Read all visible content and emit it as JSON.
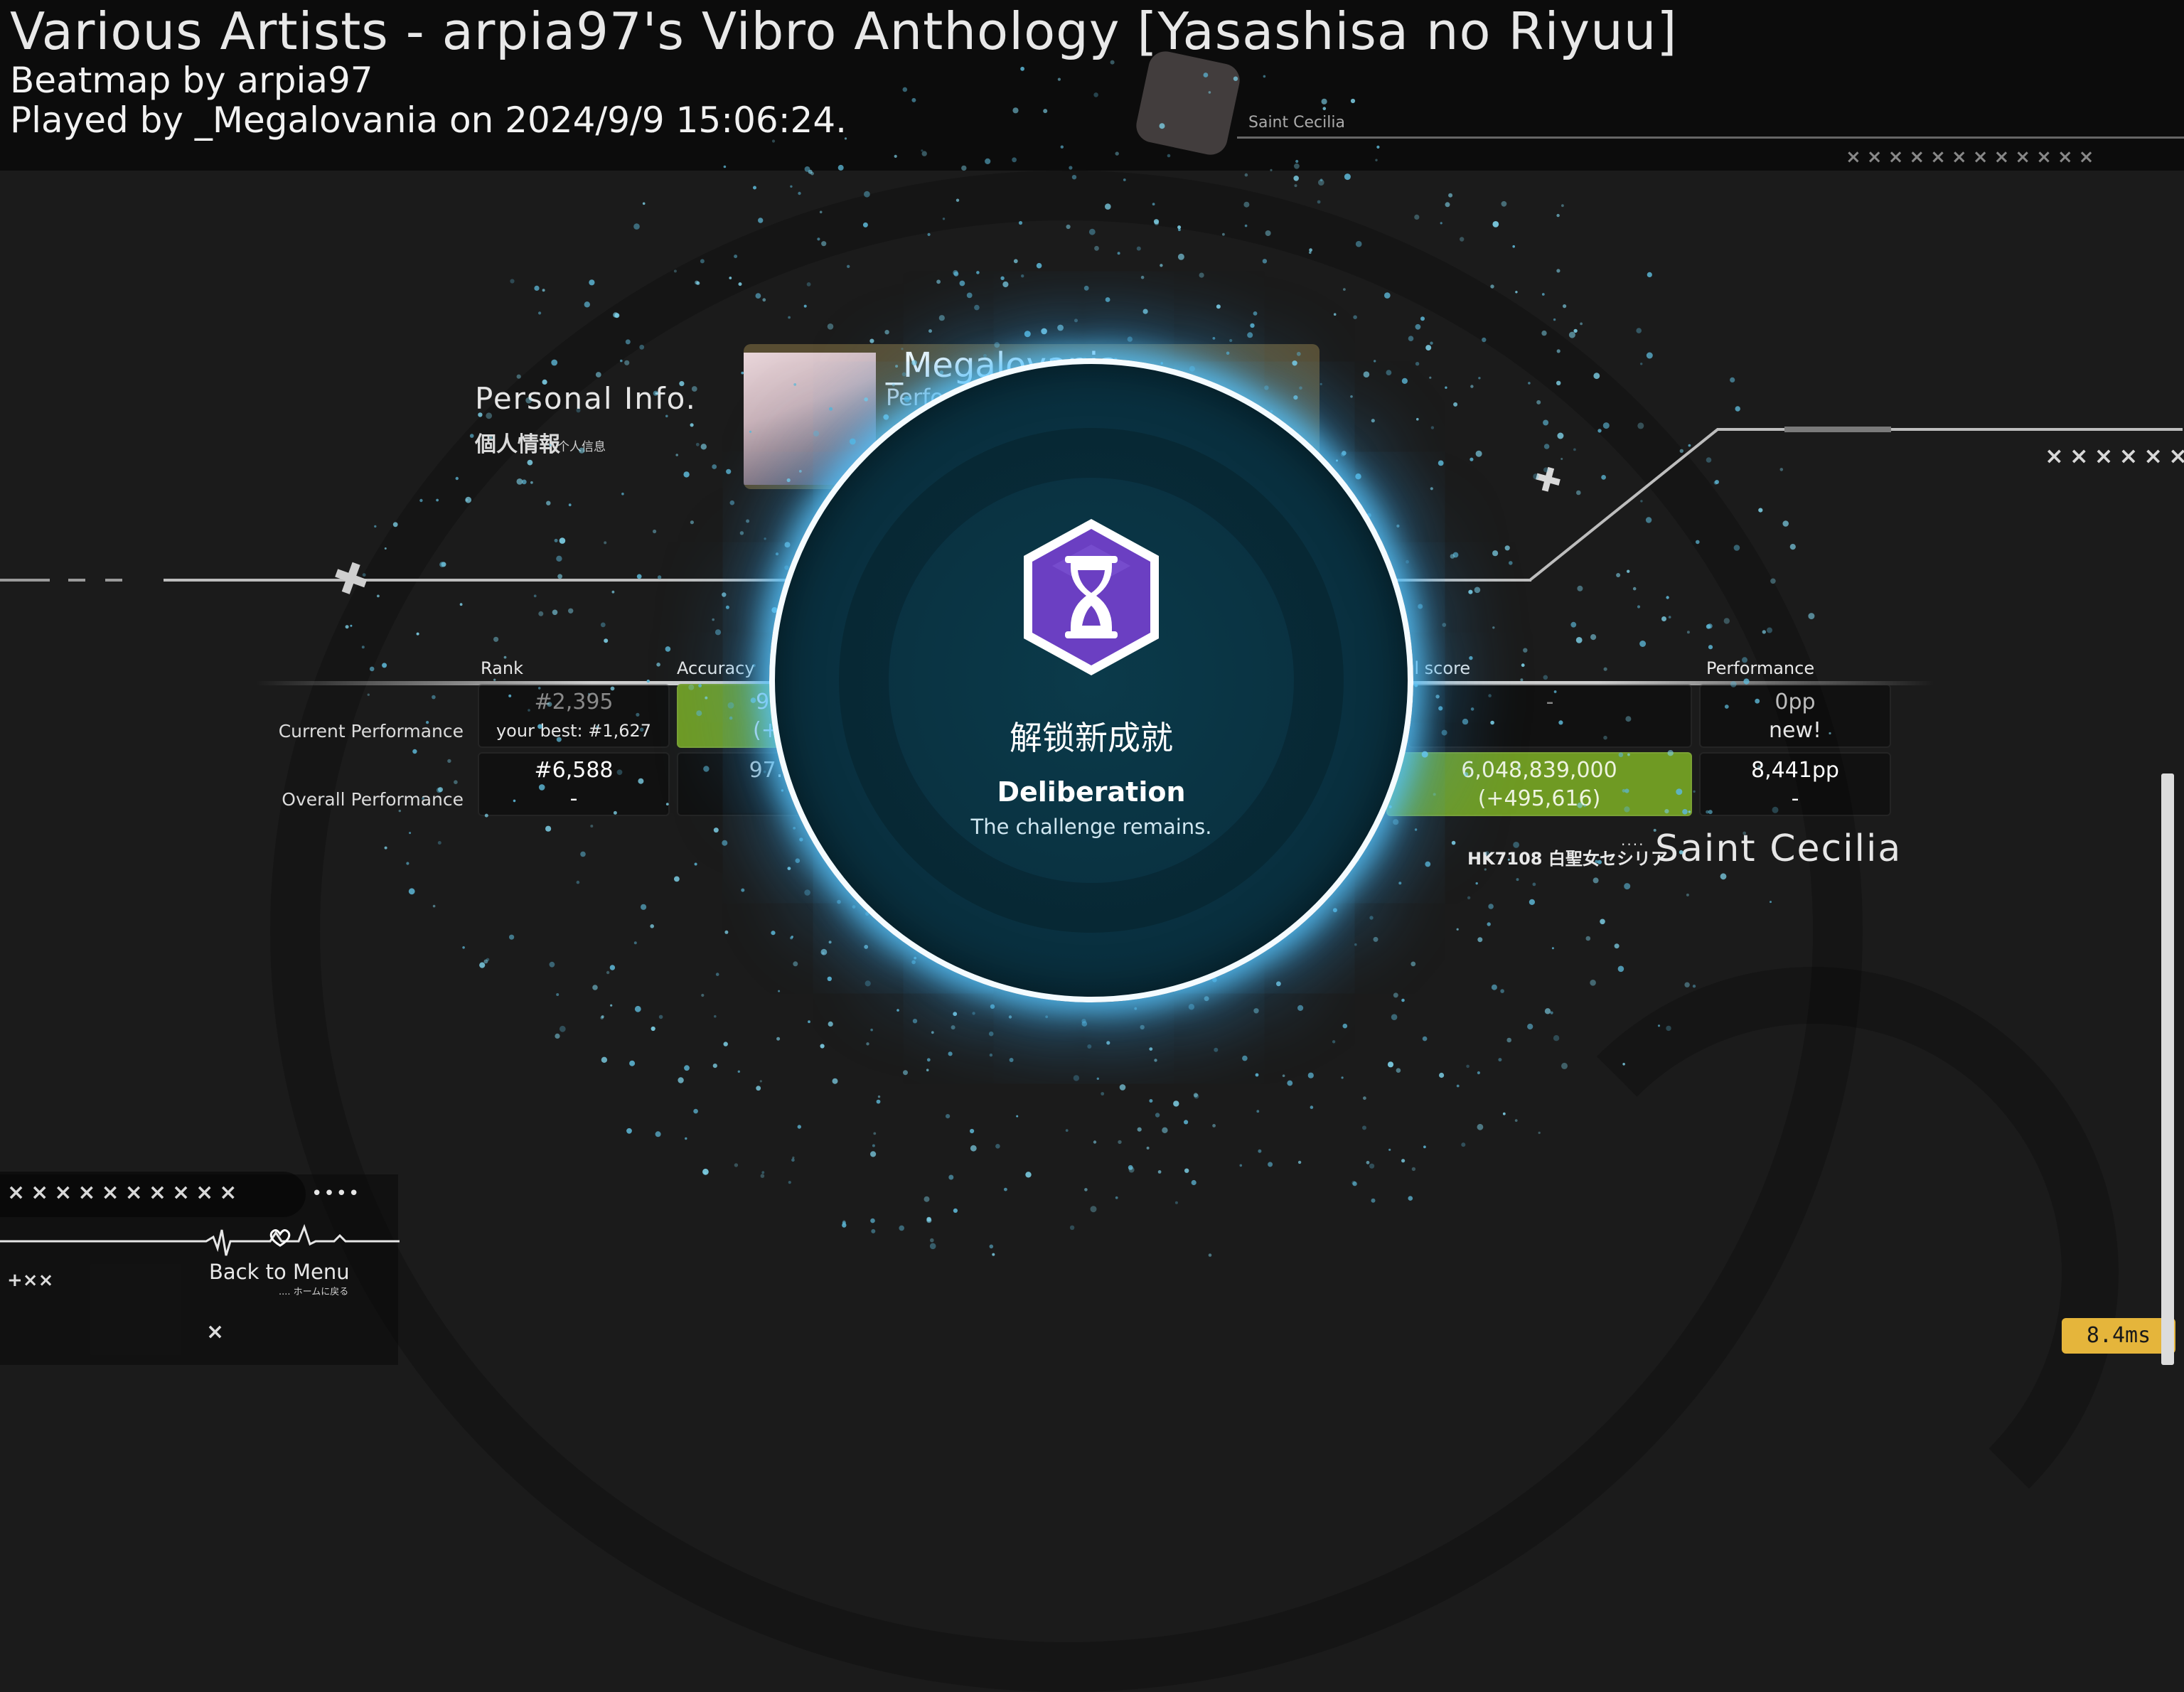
{
  "header": {
    "song_title": "Various Artists - arpia97's Vibro Anthology [Yasashisa no Riyuu]",
    "mapper_line": "Beatmap by arpia97",
    "player_line": "Played by _Megalovania on 2024/9/9 15:06:24."
  },
  "personal_info": {
    "title": "Personal Info.",
    "subtitle": "個人情報",
    "subtitle_small": "个人信息"
  },
  "profile_card": {
    "name": "_Megalovania",
    "sub": "Performance"
  },
  "stats": {
    "columns": {
      "rank": "Rank",
      "accuracy": "Accuracy",
      "total_score": "Total score",
      "performance": "Performance"
    },
    "rows": {
      "current_label": "Current Performance",
      "overall_label": "Overall Performance"
    },
    "current": {
      "rank": "#2,395",
      "rank_best": "your best: #1,627",
      "accuracy": "99.",
      "accuracy_delta": "(+8",
      "total_score": "-",
      "performance": "0pp",
      "performance_note": "new!"
    },
    "overall": {
      "rank": "#6,588",
      "rank_delta": "-",
      "accuracy": "97.8",
      "total_score": "6,048,839,000",
      "total_score_delta": "(+495,616)",
      "performance": "8,441pp",
      "performance_delta": "-"
    }
  },
  "skin": {
    "code": "HK7108 白聖女セシリア",
    "dots": "....",
    "name": "Saint Cecilia",
    "top_label": "Saint Cecilia"
  },
  "achievement": {
    "heading": "解锁新成就",
    "name": "Deliberation",
    "description": "The challenge remains.",
    "icon": "hourglass-icon"
  },
  "back": {
    "label": "Back to Menu",
    "sub": ".... ホームに戻る",
    "x_row": "××××××××××",
    "dots": "••••"
  },
  "deco": {
    "x_top": "××××××××××××",
    "x_right": "××××××"
  },
  "fps": "8.4ms",
  "colors": {
    "accent_glow": "#5ac8ff",
    "green_cell": "#6f9a23",
    "fps_bg": "#e5b53b"
  }
}
